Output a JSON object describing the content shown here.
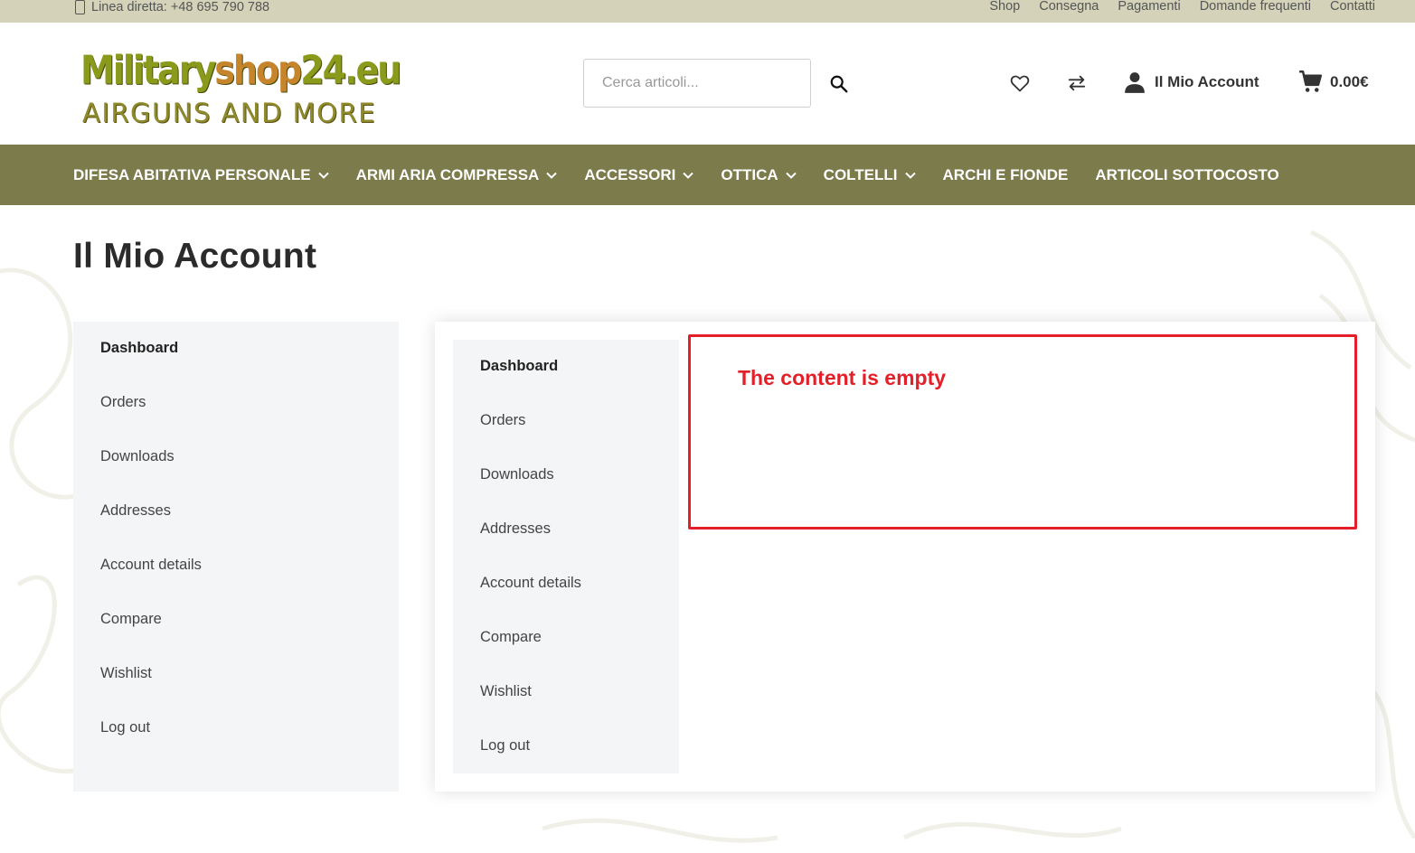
{
  "topbar": {
    "phone": "Linea diretta: +48 695 790 788",
    "links": [
      "Shop",
      "Consegna",
      "Pagamenti",
      "Domande frequenti",
      "Contatti"
    ]
  },
  "header": {
    "logo_line1_a": "Military",
    "logo_line1_b": "shop",
    "logo_line1_c": "24.eu",
    "logo_line2": "AIRGUNS AND MORE",
    "search_placeholder": "Cerca articoli...",
    "account_label": "Il Mio Account",
    "cart_total": "0.00€"
  },
  "nav": {
    "items": [
      {
        "label": "DIFESA ABITATIVA PERSONALE",
        "has_dropdown": true
      },
      {
        "label": "ARMI ARIA COMPRESSA",
        "has_dropdown": true
      },
      {
        "label": "ACCESSORI",
        "has_dropdown": true
      },
      {
        "label": "OTTICA",
        "has_dropdown": true
      },
      {
        "label": "COLTELLI",
        "has_dropdown": true
      },
      {
        "label": "ARCHI E FIONDE",
        "has_dropdown": false
      },
      {
        "label": "ARTICOLI SOTTOCOSTO",
        "has_dropdown": false
      }
    ]
  },
  "page": {
    "title": "Il Mio Account"
  },
  "account_menu": {
    "items": [
      "Dashboard",
      "Orders",
      "Downloads",
      "Addresses",
      "Account details",
      "Compare",
      "Wishlist",
      "Log out"
    ],
    "active": "Dashboard"
  },
  "content": {
    "empty_message": "The content is empty"
  },
  "colors": {
    "topbar": "#d4d3b9",
    "nav": "#7c7b4c",
    "sidebar": "#f4f5f6",
    "alert": "#e3202a"
  }
}
